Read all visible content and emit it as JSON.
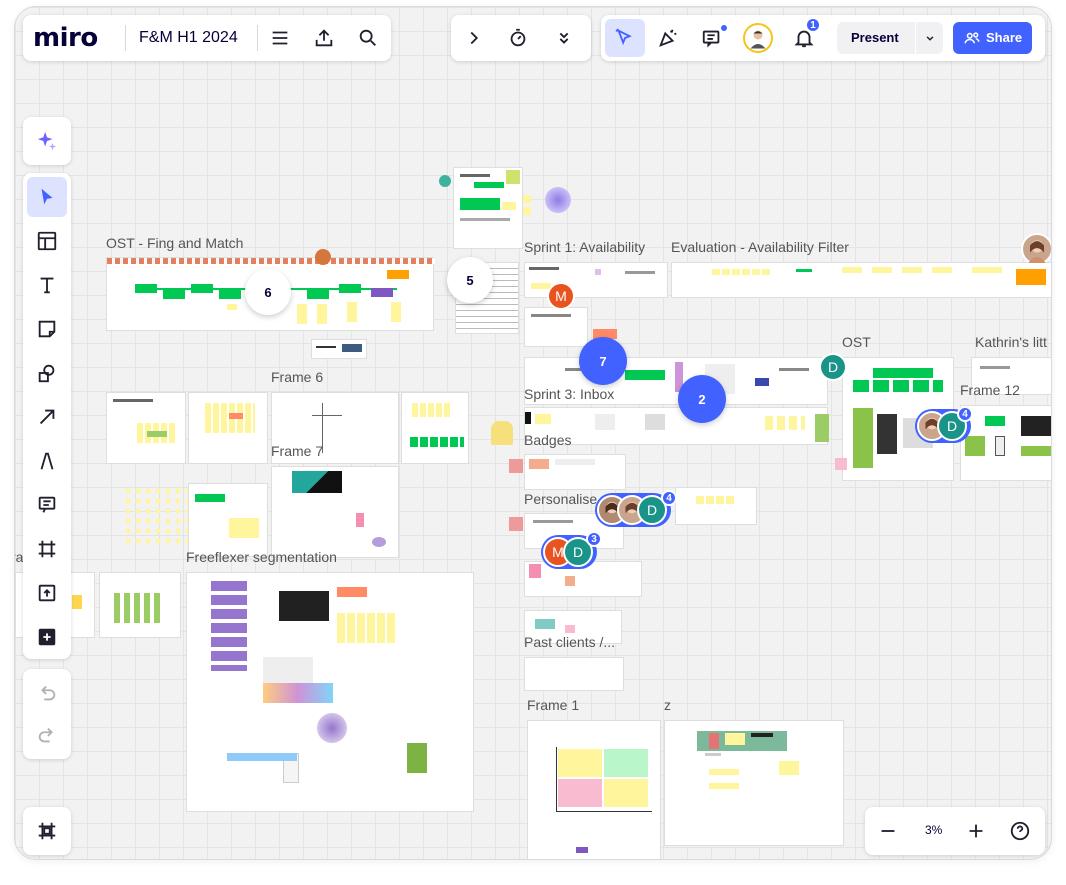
{
  "app": {
    "logo": "miro",
    "board_title": "F&M H1 2024"
  },
  "top_toolbar": {
    "present_label": "Present",
    "share_label": "Share",
    "notification_count": "1"
  },
  "zoom": {
    "level": "3%"
  },
  "frames": {
    "ost_fing": "OST - Fing and Match",
    "sprint1": "Sprint 1: Availability",
    "evaluation": "Evaluation - Availability Filter",
    "ost": "OST",
    "kathrin": "Kathrin's litt",
    "frame6": "Frame 6",
    "frame7": "Frame 7",
    "frame12": "Frame 12",
    "sprint3": "Sprint 3: Inbox",
    "badges": "Badges",
    "personalise": "Personalise",
    "freeflexer": "Freeflexer segmentation",
    "past_clients": "Past clients /...",
    "frame1": "Frame 1",
    "z": "z",
    "left_cut": "ra"
  },
  "comment_bubbles": {
    "b6": "6",
    "b5": "5",
    "b7": "7",
    "b2": "2"
  },
  "collaborators": {
    "m_initial": "M",
    "d_initial": "D",
    "cluster1_count": "4",
    "cluster2_count": "4",
    "cluster3_count": "3"
  },
  "colors": {
    "brand_blue": "#4262ff",
    "sticky_yellow": "#fff59d",
    "green": "#00c853",
    "teal_avatar": "#1a9488",
    "orange_avatar": "#e8541f"
  }
}
